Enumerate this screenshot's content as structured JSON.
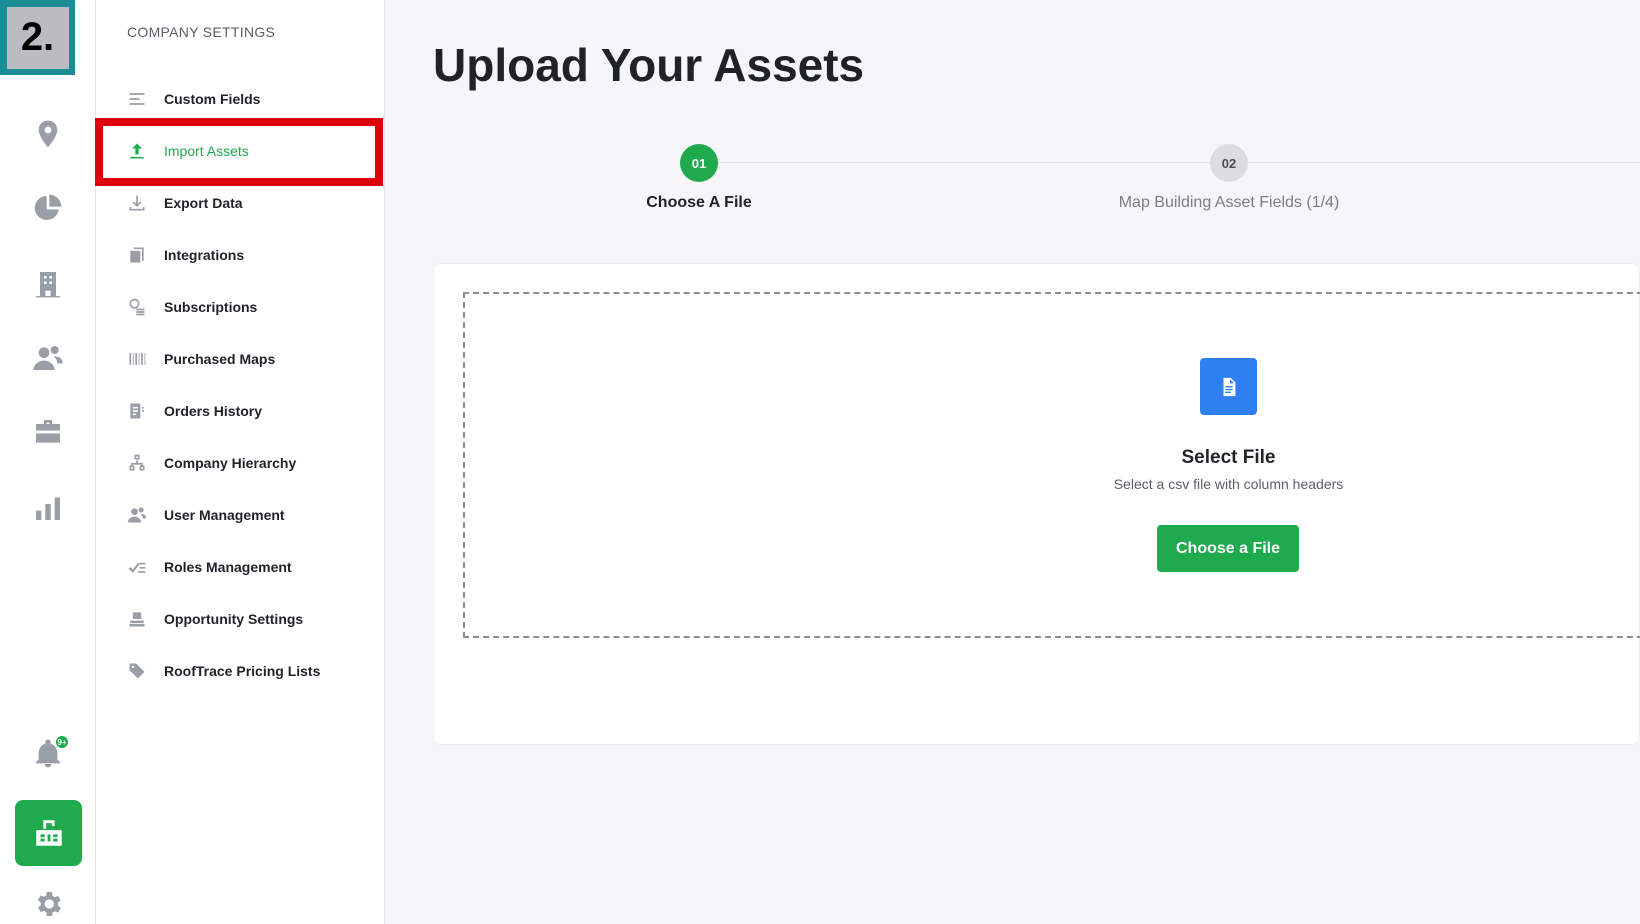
{
  "annotation": {
    "step_tag": "2."
  },
  "rail": {
    "notification_badge": "9+",
    "icons": [
      "location-pin-icon",
      "pie-chart-icon",
      "building-icon",
      "users-icon",
      "briefcase-icon",
      "bar-chart-icon",
      "bell-icon",
      "company-icon",
      "gear-icon"
    ]
  },
  "settings": {
    "section_title": "COMPANY SETTINGS",
    "items": [
      {
        "label": "Custom Fields",
        "icon": "lines-icon"
      },
      {
        "label": "Import Assets",
        "icon": "upload-icon",
        "active": true
      },
      {
        "label": "Export Data",
        "icon": "download-icon"
      },
      {
        "label": "Integrations",
        "icon": "integrations-icon"
      },
      {
        "label": "Subscriptions",
        "icon": "coins-icon"
      },
      {
        "label": "Purchased Maps",
        "icon": "barcode-icon"
      },
      {
        "label": "Orders History",
        "icon": "receipt-icon"
      },
      {
        "label": "Company Hierarchy",
        "icon": "hierarchy-icon"
      },
      {
        "label": "User Management",
        "icon": "users-icon"
      },
      {
        "label": "Roles Management",
        "icon": "checklist-icon"
      },
      {
        "label": "Opportunity Settings",
        "icon": "stack-icon"
      },
      {
        "label": "RoofTrace Pricing Lists",
        "icon": "tag-icon"
      }
    ]
  },
  "main": {
    "title": "Upload Your Assets",
    "steps": [
      {
        "number": "01",
        "label": "Choose A File",
        "active": true
      },
      {
        "number": "02",
        "label": "Map Building Asset Fields (1/4)",
        "active": false
      }
    ],
    "upload": {
      "title": "Select File",
      "subtitle": "Select a csv file with column headers",
      "button": "Choose a File"
    }
  },
  "colors": {
    "accent": "#1faa4d",
    "file_icon": "#2e7ff0",
    "highlight": "#e0000c",
    "tag": "#1a8c96"
  }
}
